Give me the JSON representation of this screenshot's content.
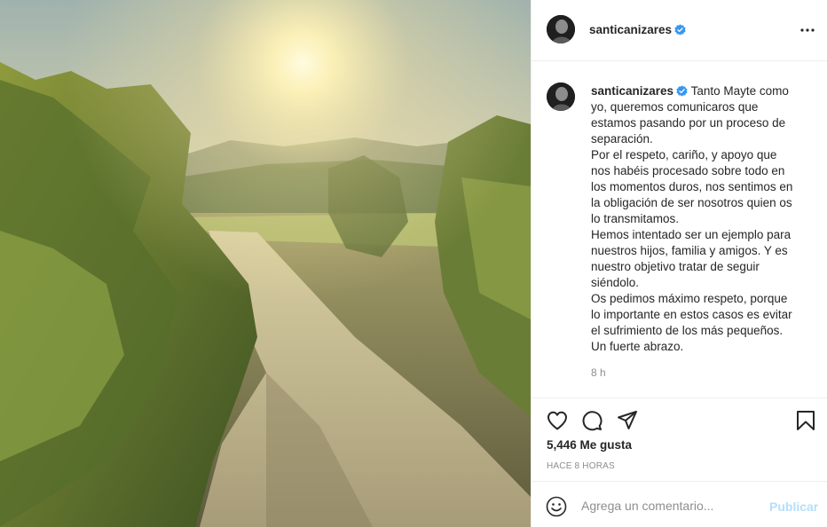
{
  "post": {
    "image_alt": "sunlit dirt path through green hills",
    "username": "santicanizares",
    "verified_icon": "verified-badge-icon",
    "more_icon": "more-options-icon"
  },
  "caption": {
    "username": "santicanizares",
    "lines": [
      " Tanto Mayte como",
      "yo, queremos comunicaros que",
      "estamos pasando por un proceso de",
      "separación.",
      "Por el respeto, cariño, y apoyo que",
      "nos habéis procesado sobre todo en",
      "los momentos duros, nos sentimos en",
      "la obligación de ser nosotros quien os",
      "lo transmitamos.",
      "Hemos intentado ser un ejemplo para",
      "nuestros hijos, familia y amigos. Y es",
      "nuestro objetivo tratar de seguir",
      "siéndolo.",
      "Os pedimos máximo respeto, porque",
      "lo importante en estos casos es evitar",
      "el sufrimiento de los más pequeños.",
      "Un fuerte abrazo."
    ],
    "time_ago": "8 h"
  },
  "actions": {
    "like_icon": "heart-icon",
    "comment_icon": "comment-icon",
    "share_icon": "share-icon",
    "save_icon": "bookmark-icon"
  },
  "stats": {
    "likes": "5,446 Me gusta",
    "posted": "HACE 8 HORAS"
  },
  "comment_bar": {
    "emoji_icon": "emoji-icon",
    "placeholder": "Agrega un comentario...",
    "publish_label": "Publicar"
  },
  "colors": {
    "accent_disabled": "#b2dffc",
    "verified": "#3897f0",
    "muted_text": "#8e8e8e"
  }
}
